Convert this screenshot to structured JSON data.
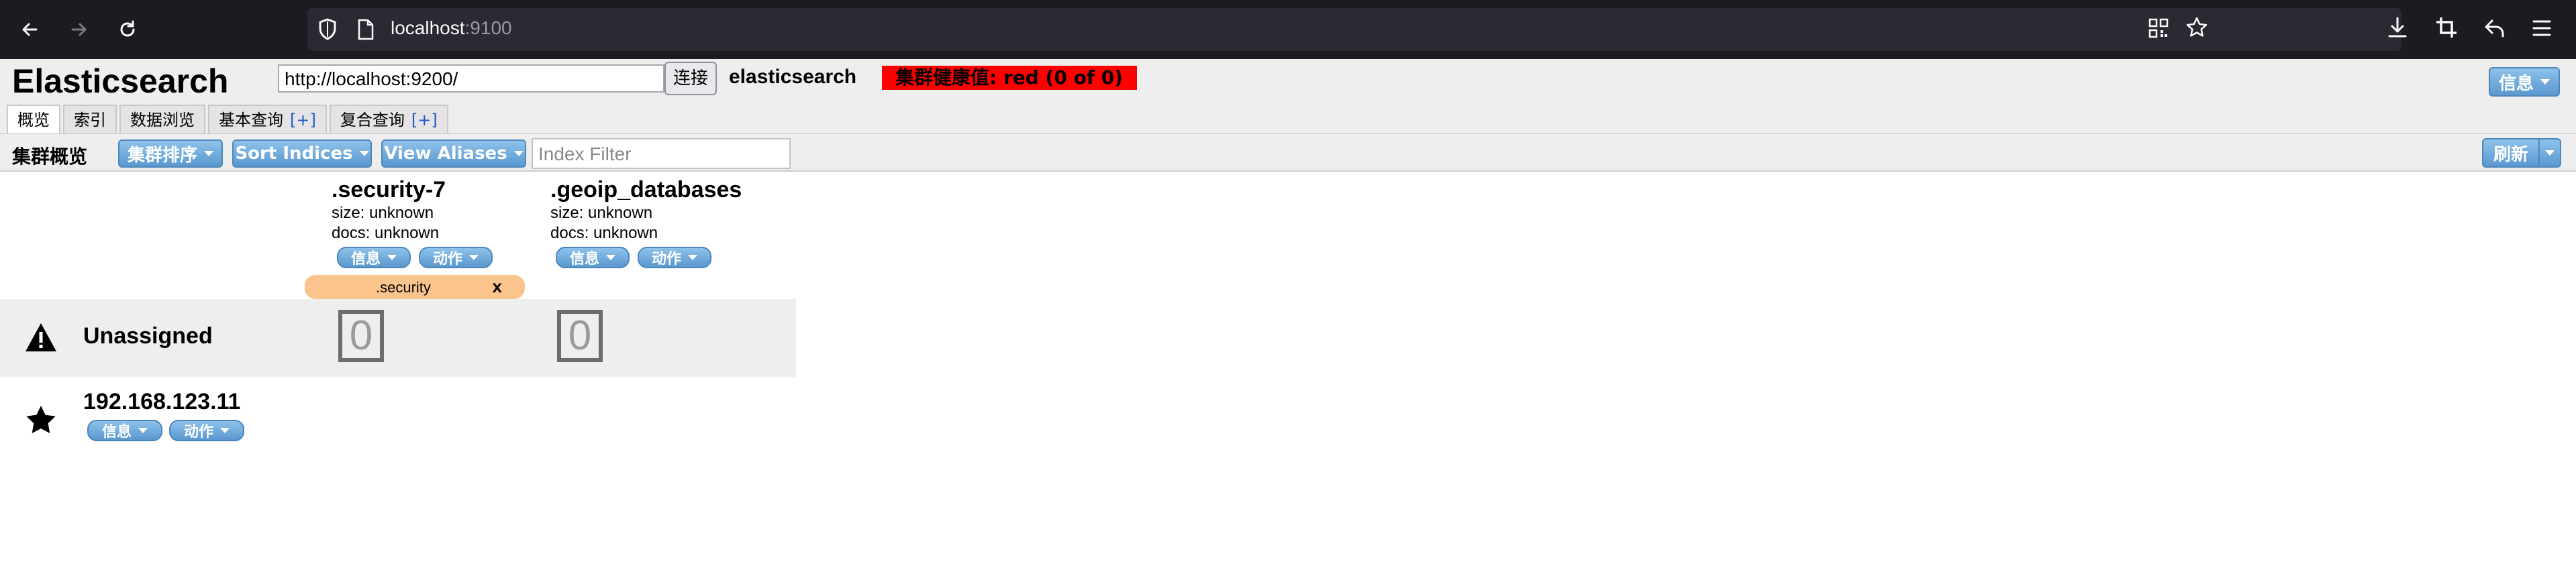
{
  "browser": {
    "url_host": "localhost",
    "url_port": ":9100"
  },
  "header": {
    "app_title": "Elasticsearch",
    "connect_url": "http://localhost:9200/",
    "connect_button": "连接",
    "cluster_name": "elasticsearch",
    "health_status": "集群健康值: red (0 of 0)",
    "info_button": "信息"
  },
  "tabs": [
    {
      "label": "概览",
      "plus": ""
    },
    {
      "label": "索引",
      "plus": ""
    },
    {
      "label": "数据浏览",
      "plus": ""
    },
    {
      "label": "基本查询",
      "plus": "[+]"
    },
    {
      "label": "复合查询",
      "plus": "[+]"
    }
  ],
  "toolbar": {
    "title": "集群概览",
    "cluster_sort": "集群排序",
    "sort_indices": "Sort Indices",
    "view_aliases": "View Aliases",
    "index_filter_placeholder": "Index Filter",
    "refresh": "刷新"
  },
  "indices": [
    {
      "name": ".security-7",
      "size": "size: unknown",
      "docs": "docs: unknown",
      "info_button": "信息",
      "action_button": "动作",
      "alias": ".security",
      "alias_close": "x",
      "unassigned_shard": "0"
    },
    {
      "name": ".geoip_databases",
      "size": "size: unknown",
      "docs": "docs: unknown",
      "info_button": "信息",
      "action_button": "动作",
      "unassigned_shard": "0"
    }
  ],
  "unassigned": {
    "label": "Unassigned",
    "icon": "warning-icon"
  },
  "node": {
    "name": "192.168.123.11",
    "icon": "star-icon",
    "info_button": "信息",
    "action_button": "动作"
  },
  "colors": {
    "health_red": "#ff0000",
    "button_blue": "#5a98cf",
    "alias_orange": "#fbc48d",
    "chrome_dark": "#1c1b22"
  }
}
